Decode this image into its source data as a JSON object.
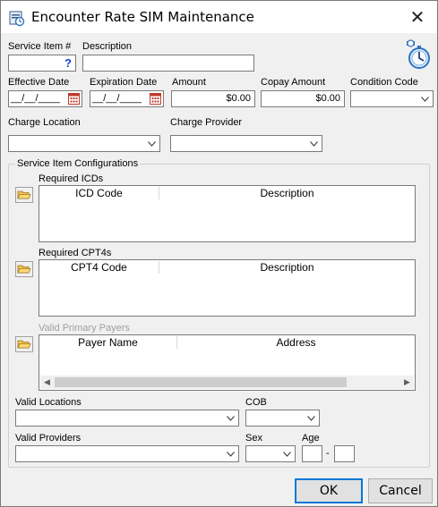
{
  "window": {
    "title": "Encounter Rate SIM Maintenance",
    "close_glyph": "✕",
    "icon": "sim-maintenance-icon"
  },
  "top": {
    "service_item_label": "Service Item #",
    "service_item_value": "",
    "service_item_help": "?",
    "description_label": "Description",
    "description_value": ""
  },
  "dates": {
    "effective_label": "Effective Date",
    "effective_value": "__/__/____",
    "expiration_label": "Expiration Date",
    "expiration_value": "__/__/____"
  },
  "amounts": {
    "amount_label": "Amount",
    "amount_value": "$0.00",
    "copay_label": "Copay Amount",
    "copay_value": "$0.00",
    "condition_label": "Condition Code",
    "condition_value": ""
  },
  "charge": {
    "location_label": "Charge Location",
    "location_value": "",
    "provider_label": "Charge Provider",
    "provider_value": ""
  },
  "config": {
    "title": "Service Item Configurations",
    "icds": {
      "label": "Required ICDs",
      "columns": [
        "ICD Code",
        "Description"
      ],
      "rows": []
    },
    "cpt4s": {
      "label": "Required CPT4s",
      "columns": [
        "CPT4 Code",
        "Description"
      ],
      "rows": []
    },
    "payers": {
      "label": "Valid Primary Payers",
      "columns": [
        "Payer Name",
        "Address"
      ],
      "rows": []
    },
    "locations_label": "Valid Locations",
    "locations_value": "",
    "cob_label": "COB",
    "cob_value": "",
    "providers_label": "Valid Providers",
    "providers_value": "",
    "sex_label": "Sex",
    "sex_value": "",
    "age_label": "Age",
    "age_from": "",
    "age_sep": "-",
    "age_to": ""
  },
  "buttons": {
    "ok": "OK",
    "cancel": "Cancel"
  },
  "colors": {
    "accent": "#0078d7",
    "help": "#1a3fd1",
    "calendar": "#c0392b"
  }
}
